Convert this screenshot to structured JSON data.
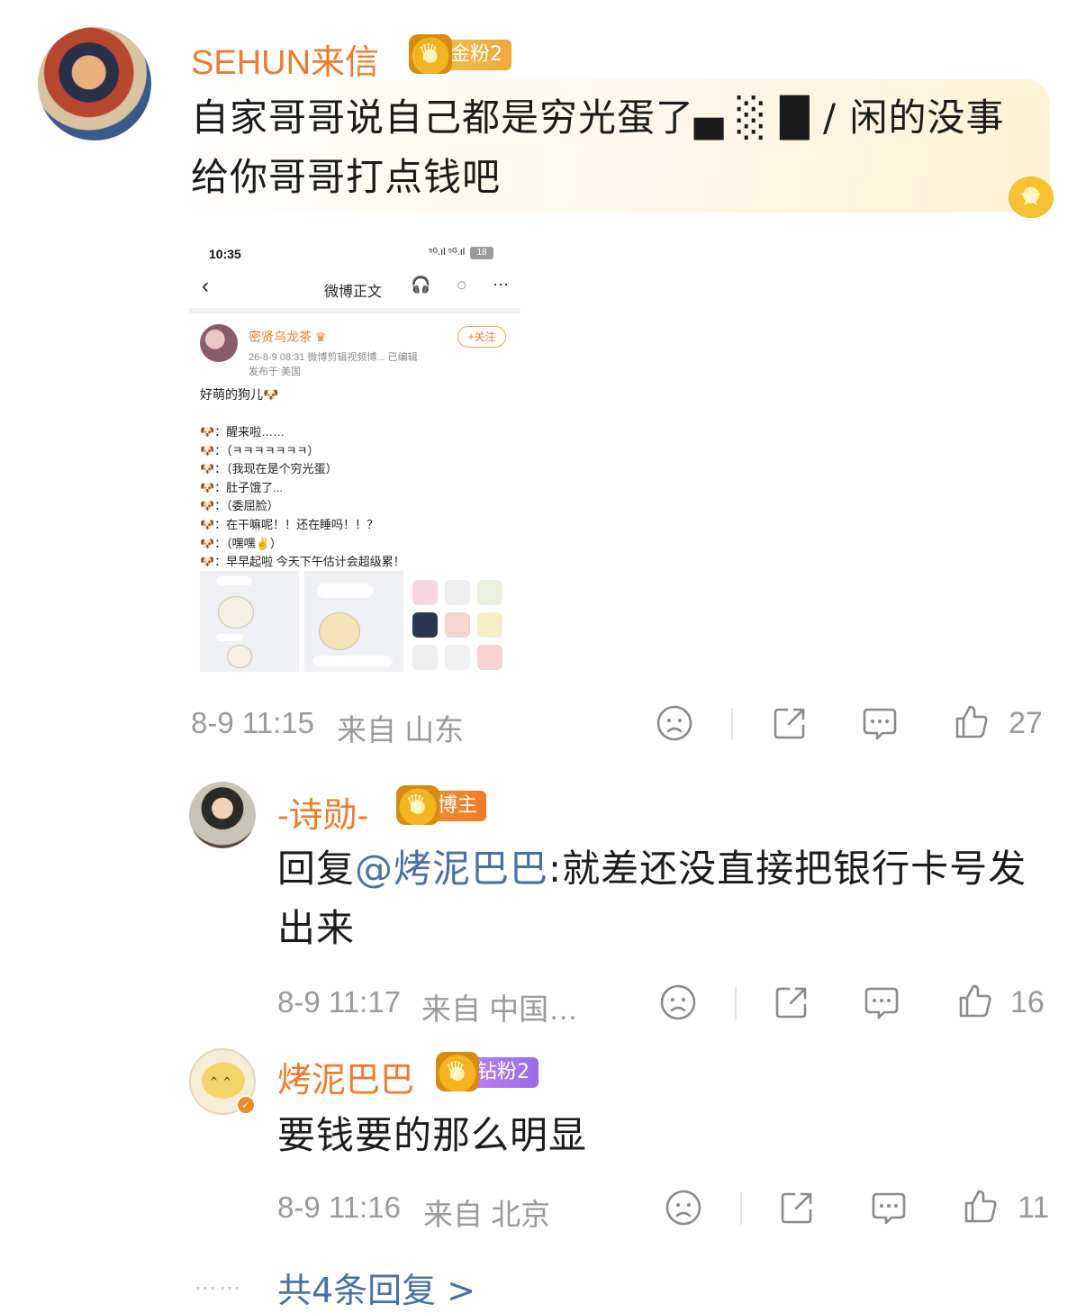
{
  "main_comment": {
    "username": "SEHUN来信",
    "badge": "金粉2",
    "text": "自家哥哥说自己都是穷光蛋了▄ ░ █ / 闲的没事给你哥哥打点钱吧",
    "time": "8-9 11:15",
    "location": "来自 山东",
    "likes": "27"
  },
  "embedded_screenshot": {
    "status_time": "10:35",
    "status_signal": "⁵ᴳ.ıl ⁵ᴳ.ıl",
    "battery": "18",
    "nav_title": "微博正文",
    "nav_icons": "🎧 ◌ ⋯",
    "poster_name": "密贤乌龙茶 ♛",
    "poster_meta": "26-8-9 08:31  微博剪辑视频博...  已编辑",
    "poster_location": "发布于 美国",
    "follow_label": "+关注",
    "post_text": "好萌的狗儿🐶",
    "lines": [
      "🐶：醒来啦……",
      "🐶：（ㅋㅋㅋㅋㅋㅋㅋ）",
      "🐶：（我现在是个穷光蛋）",
      "🐶：肚子饿了...",
      "🐶：（委屈脸）",
      "🐶：在干嘛呢！！还在睡吗！！？",
      "🐶：（嘿嘿✌）",
      "🐶：早早起啦 今天下午估计会超级累！"
    ]
  },
  "replies": [
    {
      "username": "-诗勋-",
      "badge": "博主",
      "reply_prefix": "回复",
      "mention": "@烤泥巴巴",
      "text": ":就差还没直接把银行卡号发出来",
      "time": "8-9 11:17",
      "location": "来自 中国…",
      "likes": "16"
    },
    {
      "username": "烤泥巴巴",
      "badge": "钻粉2",
      "text": "要钱要的那么明显",
      "time": "8-9 11:16",
      "location": "来自 北京",
      "likes": "11"
    }
  ],
  "more_replies": {
    "dots": "……",
    "label": "共4条回复 >"
  },
  "icons": [
    "sad-face-icon",
    "share-icon",
    "comment-icon",
    "thumbs-up-icon",
    "crown-icon",
    "star-medal-icon"
  ],
  "colors": {
    "username": "#f07a2a",
    "mention": "#4a6fa5",
    "meta": "#9a9a9a"
  }
}
